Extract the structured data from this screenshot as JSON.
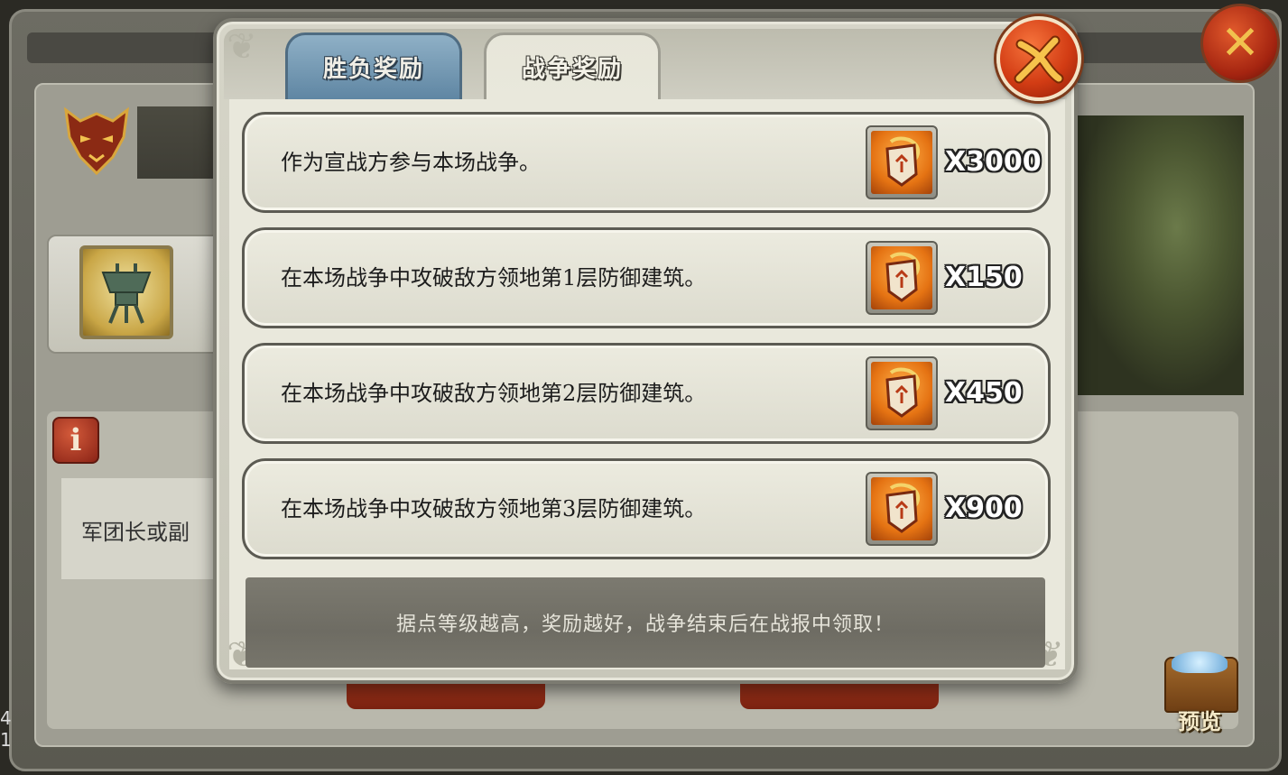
{
  "dialog": {
    "tabs": [
      {
        "label": "胜负奖励",
        "active": false
      },
      {
        "label": "战争奖励",
        "active": true
      }
    ],
    "close_icon": "close-x-icon",
    "rewards": [
      {
        "description": "作为宣战方参与本场战争。",
        "quantity": "X3000",
        "icon": "war-token-icon"
      },
      {
        "description": "在本场战争中攻破敌方领地第1层防御建筑。",
        "quantity": "X150",
        "icon": "war-token-icon"
      },
      {
        "description": "在本场战争中攻破敌方领地第2层防御建筑。",
        "quantity": "X450",
        "icon": "war-token-icon"
      },
      {
        "description": "在本场战争中攻破敌方领地第3层防御建筑。",
        "quantity": "X900",
        "icon": "war-token-icon"
      }
    ],
    "footer_note": "据点等级越高，奖励越好，战争结束后在战报中领取！",
    "colors": {
      "tab_inactive": "#6f95b0",
      "close_button": "#d23c14",
      "reward_icon": "#e57313"
    }
  },
  "background": {
    "info_text": "军团长或副",
    "info_icon": "info-icon",
    "preview_label": "预览",
    "left_digits": [
      "4",
      "1"
    ]
  }
}
